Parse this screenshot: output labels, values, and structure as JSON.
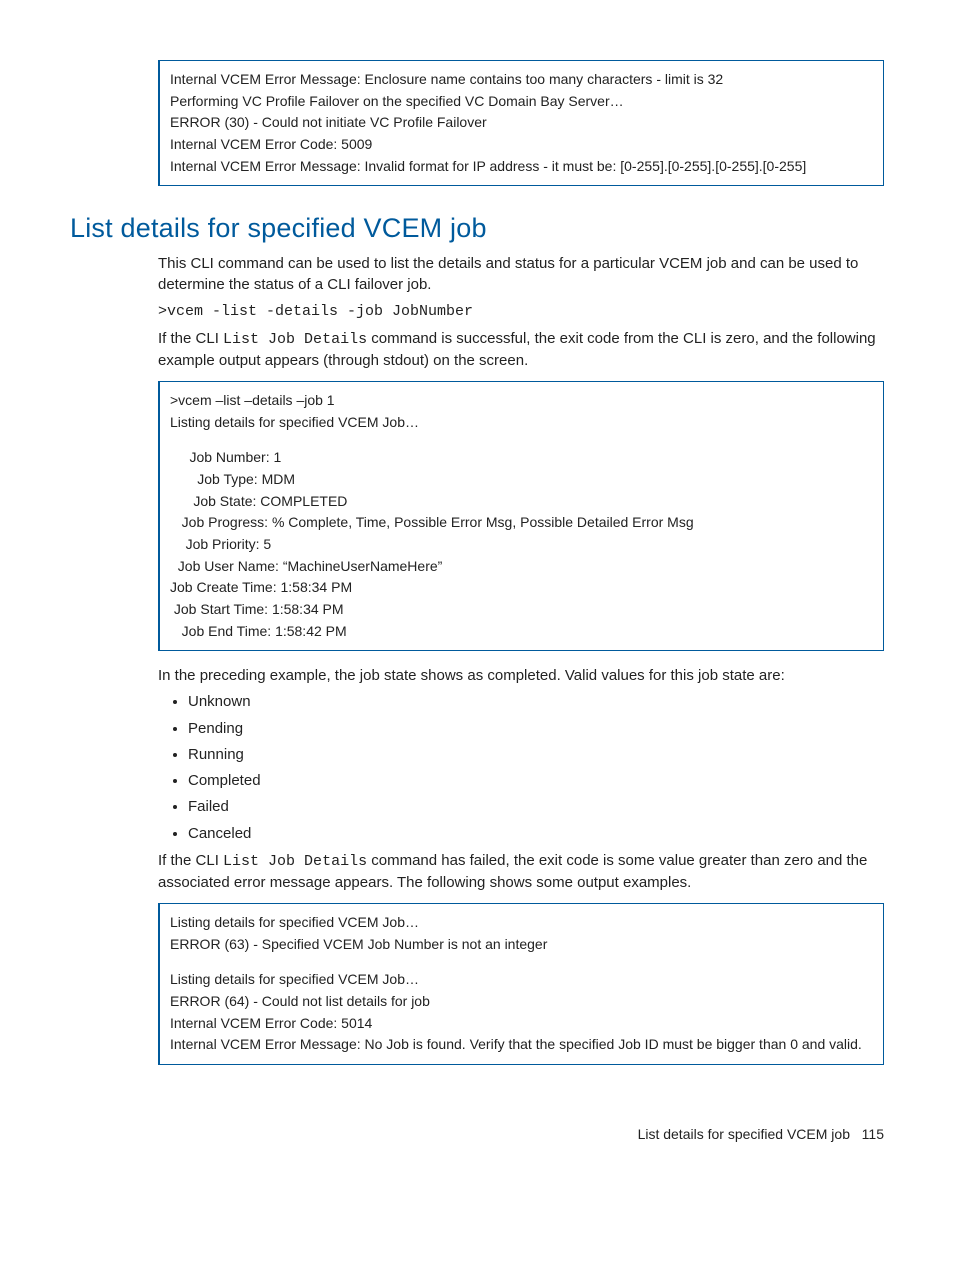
{
  "box1": {
    "lines": [
      "Internal VCEM Error Message: Enclosure name contains too many characters - limit is 32",
      "Performing VC Profile Failover on the specified VC Domain Bay Server…",
      "ERROR (30) - Could not initiate VC Profile Failover",
      "Internal VCEM Error Code: 5009",
      "Internal VCEM Error Message: Invalid format for IP address - it must be: [0-255].[0-255].[0-255].[0-255]"
    ]
  },
  "heading": "List details for specified VCEM job",
  "para1": "This CLI command can be used to list the details and status for a particular VCEM job and can be used to determine the status of a CLI failover job.",
  "cmd1": ">vcem -list -details -job JobNumber",
  "para2_a": "If the CLI ",
  "para2_code": "List Job Details",
  "para2_b": " command is successful, the exit code from the CLI is zero, and the following example output appears (through stdout) on the screen.",
  "box2": {
    "cmdline": ">vcem –list –details –job 1",
    "subline": "Listing details for specified VCEM Job…",
    "rows": [
      {
        "label": "Job Number:",
        "value": "1",
        "pad": "     "
      },
      {
        "label": "Job Type:",
        "value": "MDM",
        "pad": "       "
      },
      {
        "label": "Job State:",
        "value": "COMPLETED",
        "pad": "      "
      },
      {
        "label": "Job Progress:",
        "value": "% Complete, Time, Possible Error Msg, Possible Detailed Error Msg",
        "pad": "   "
      },
      {
        "label": "Job Priority:",
        "value": "5",
        "pad": "    "
      },
      {
        "label": "Job User Name:",
        "value": "“MachineUserNameHere”",
        "pad": "  "
      },
      {
        "label": "Job Create Time:",
        "value": "1:58:34 PM",
        "pad": ""
      },
      {
        "label": "Job Start Time:",
        "value": "1:58:34 PM",
        "pad": " "
      },
      {
        "label": "Job End Time:",
        "value": "1:58:42 PM",
        "pad": "   "
      }
    ]
  },
  "para3": "In the preceding example, the job state shows as completed. Valid values for this job state are:",
  "bullets": [
    "Unknown",
    "Pending",
    "Running",
    "Completed",
    "Failed",
    "Canceled"
  ],
  "para4_a": "If the CLI ",
  "para4_code": "List Job Details",
  "para4_b": " command has failed, the exit code is some value greater than zero and the associated error message appears. The following shows some output examples.",
  "box3": {
    "lines": [
      "Listing details for specified VCEM Job…",
      "ERROR (63) - Specified VCEM Job Number is not an integer",
      "",
      "Listing details for specified VCEM Job…",
      "ERROR (64) - Could not list details for job",
      "Internal VCEM Error Code: 5014",
      "Internal VCEM Error Message: No Job is found. Verify that the specified Job ID must be bigger than 0 and valid."
    ]
  },
  "footer_text": "List details for specified VCEM job",
  "footer_page": "115"
}
